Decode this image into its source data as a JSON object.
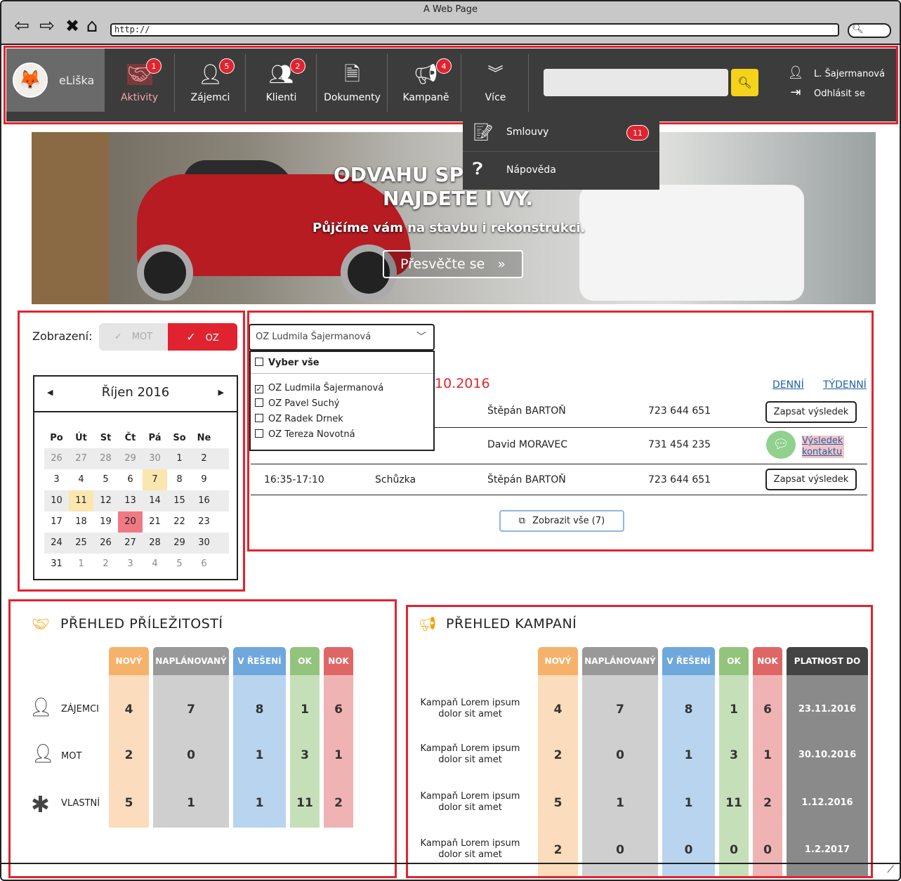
{
  "browser": {
    "title": "A Web Page",
    "url": "http://"
  },
  "app": {
    "brand": "eLiška",
    "nav": [
      {
        "label": "Aktivity",
        "badge": "1",
        "icon": "handshake-icon"
      },
      {
        "label": "Zájemci",
        "badge": "5",
        "icon": "person-question-icon"
      },
      {
        "label": "Klienti",
        "badge": "2",
        "icon": "group-icon"
      },
      {
        "label": "Dokumenty",
        "badge": "",
        "icon": "document-icon"
      },
      {
        "label": "Kampaně",
        "badge": "4",
        "icon": "megaphone-icon"
      },
      {
        "label": "Více",
        "badge": "",
        "icon": "chevron-double-down-icon"
      }
    ],
    "user": {
      "name": "L. Šajermanová",
      "logout": "Odhlásit se"
    },
    "more_menu": [
      {
        "label": "Smlouvy",
        "badge": "11",
        "icon": "contract-icon"
      },
      {
        "label": "Nápověda",
        "badge": "",
        "icon": "help-icon"
      }
    ],
    "accent": "#e0242f"
  },
  "banner": {
    "headline_1": "ODVAHU SPL",
    "headline_2": "NAJDETE I VY.",
    "subline": "Půjčíme vám na stavbu i rekonstrukci.",
    "button": "Přesvěčte se",
    "button_icon": "»"
  },
  "view": {
    "label": "Zobrazení:",
    "options": [
      "MOT",
      "OZ"
    ],
    "selected": "OZ"
  },
  "calendar": {
    "month": "Říjen 2016",
    "weekdays": [
      "Po",
      "Út",
      "St",
      "Čt",
      "Pá",
      "So",
      "Ne"
    ],
    "weeks": [
      [
        "26",
        "27",
        "28",
        "29",
        "30",
        "1",
        "2"
      ],
      [
        "3",
        "4",
        "5",
        "6",
        "7",
        "8",
        "9"
      ],
      [
        "10",
        "11",
        "12",
        "13",
        "14",
        "15",
        "16"
      ],
      [
        "17",
        "18",
        "19",
        "20",
        "21",
        "22",
        "23"
      ],
      [
        "24",
        "25",
        "26",
        "27",
        "28",
        "29",
        "30"
      ],
      [
        "31",
        "1",
        "2",
        "3",
        "4",
        "5",
        "6"
      ]
    ]
  },
  "agenda": {
    "select_value": "OZ Ludmila Šajermanová",
    "select_all": "Vyber vše",
    "options": [
      "OZ Ludmila Šajermanová",
      "OZ Pavel Suchý",
      "OZ Radek Drnek",
      "OZ Tereza Novotná"
    ],
    "date": "10.2016",
    "views": [
      "DENNÍ",
      "TÝDENNÍ"
    ],
    "rows": [
      {
        "time": "",
        "type": "",
        "name": "Štěpán BARTOŇ",
        "phone": "723 644 651",
        "action": "Zapsat výsledek"
      },
      {
        "time": "",
        "type": "",
        "name": "David MORAVEC",
        "phone": "731 454 235",
        "action": "Výsledek kontaktu"
      },
      {
        "time": "16:35-17:10",
        "type": "Schůzka",
        "name": "Štěpán BARTOŇ",
        "phone": "723 644 651",
        "action": "Zapsat výsledek"
      }
    ],
    "show_all": "Zobrazit vše (7)"
  },
  "opportunities": {
    "title": "PŘEHLED PŘÍLEŽITOSTÍ",
    "columns": [
      "NOVÝ",
      "NAPLÁNOVANÝ",
      "V ŘEŠENÍ",
      "OK",
      "NOK"
    ],
    "rows": [
      {
        "label": "ZÁJEMCI",
        "icon": "person-question-icon",
        "values": [
          "4",
          "7",
          "8",
          "1",
          "6"
        ]
      },
      {
        "label": "MOT",
        "icon": "person-tie-icon",
        "values": [
          "2",
          "0",
          "1",
          "3",
          "1"
        ]
      },
      {
        "label": "VLASTNÍ",
        "icon": "asterisk-icon",
        "values": [
          "5",
          "1",
          "1",
          "11",
          "2"
        ]
      }
    ]
  },
  "campaigns": {
    "title": "PŘEHLED KAMPANÍ",
    "columns": [
      "NOVÝ",
      "NAPLÁNOVANÝ",
      "V ŘEŠENÍ",
      "OK",
      "NOK",
      "PLATNOST DO"
    ],
    "rows": [
      {
        "label": "Kampaň Lorem ipsum dolor sit amet",
        "values": [
          "4",
          "7",
          "8",
          "1",
          "6"
        ],
        "valid_to": "23.11.2016"
      },
      {
        "label": "Kampaň Lorem ipsum dolor sit amet",
        "values": [
          "2",
          "0",
          "1",
          "3",
          "1"
        ],
        "valid_to": "30.10.2016"
      },
      {
        "label": "Kampaň Lorem ipsum dolor sit amet",
        "values": [
          "5",
          "1",
          "1",
          "11",
          "2"
        ],
        "valid_to": "1.12.2016"
      },
      {
        "label": "Kampaň Lorem ipsum dolor sit amet",
        "values": [
          "2",
          "0",
          "0",
          "0",
          "0"
        ],
        "valid_to": "1.2.2017"
      }
    ]
  },
  "status_colors": {
    "new": "#f6b26b",
    "planned": "#999999",
    "in_progress": "#6fa8dc",
    "ok": "#93c47d",
    "nok": "#e06666",
    "valid": "#444444"
  }
}
